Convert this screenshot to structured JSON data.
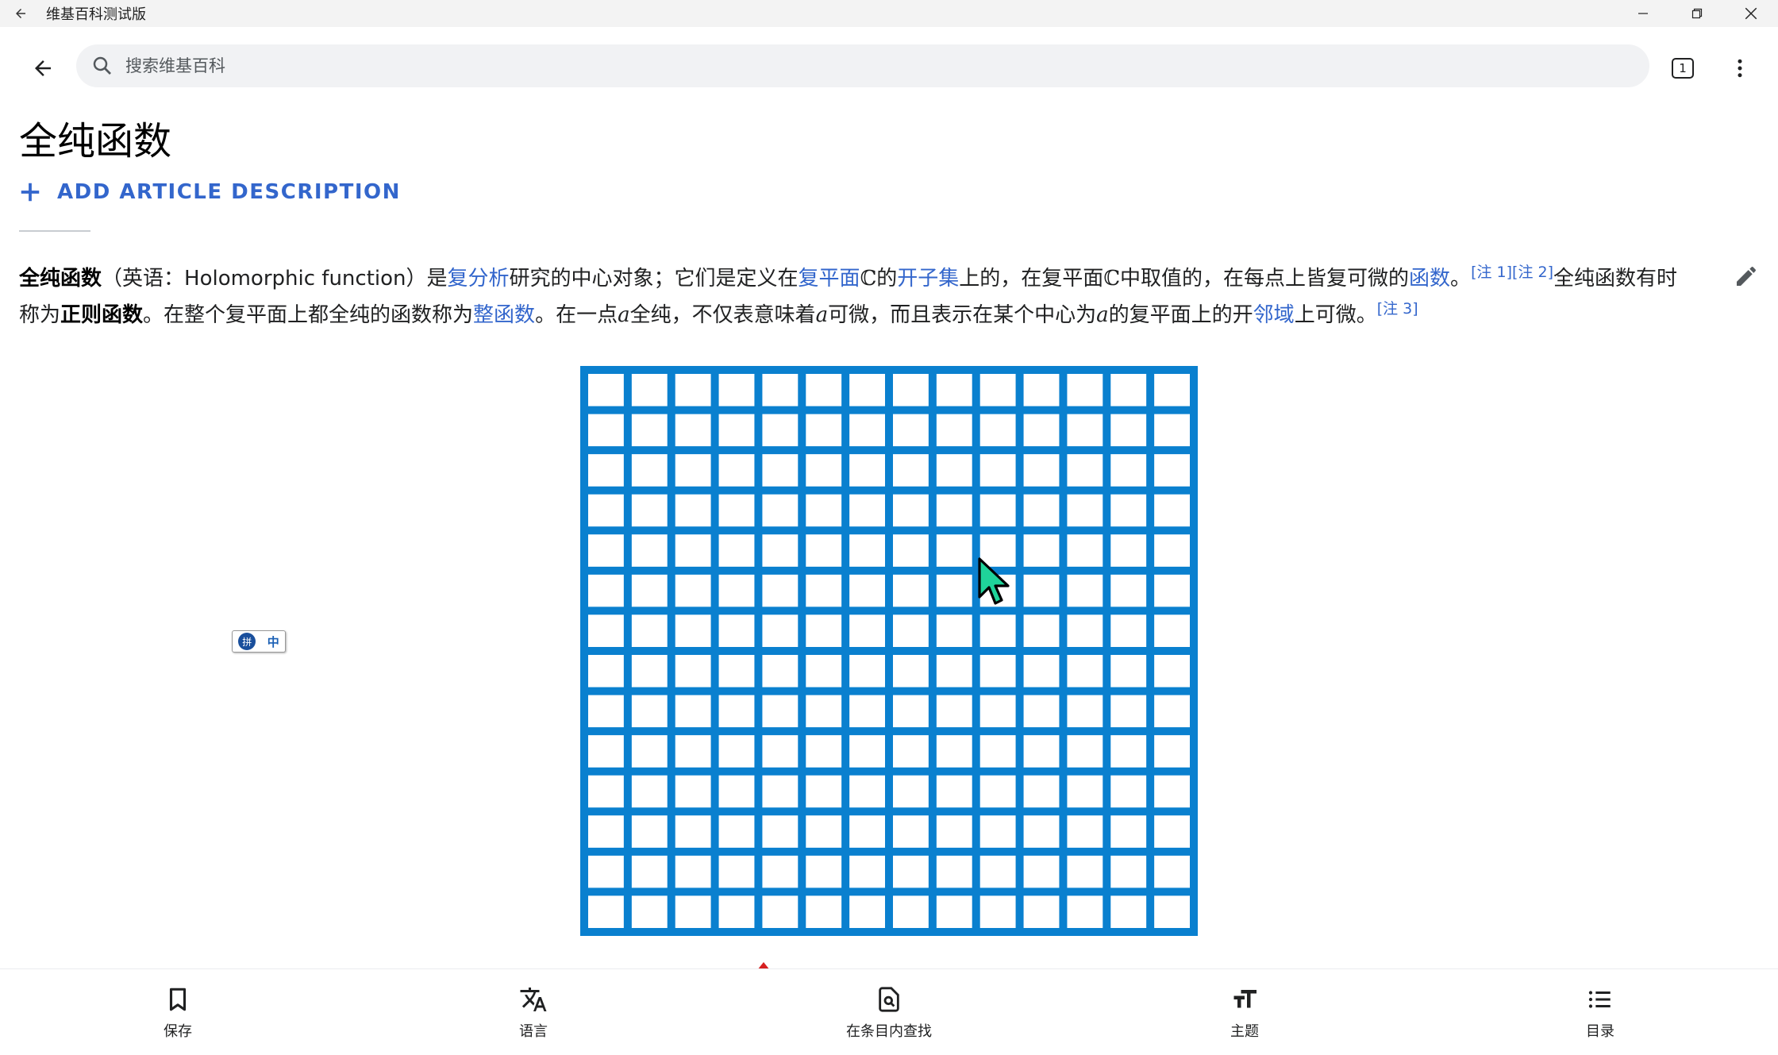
{
  "window": {
    "title": "维基百科测试版"
  },
  "toolbar": {
    "search_placeholder": "搜索维基百科",
    "tabs_count": "1"
  },
  "article": {
    "title": "全纯函数",
    "add_description": "ADD ARTICLE DESCRIPTION",
    "lead": {
      "s01": "全纯函数",
      "s02": "（英语：Holomorphic function）是",
      "s03": "复分析",
      "s04": "研究的中心对象；它们是定义在",
      "s05": "复平面",
      "s06": "ℂ",
      "s07": "的",
      "s08": "开子集",
      "s09": "上的，在复平面",
      "s10": "ℂ",
      "s11": "中取值的，在每点上皆复可微的",
      "s12": "函数",
      "s13": "。",
      "s14": "[注 1]",
      "s15": "[注 2]",
      "s16": "全纯函数有时称为",
      "s17": "正则函数",
      "s18": "。在整个复平面上都全纯的函数称为",
      "s19": "整函数",
      "s20": "。在一点",
      "s21": "a",
      "s22": "全纯，不仅表意味着",
      "s23": "a",
      "s24": "可微，而且表示在某个中心为",
      "s25": "a",
      "s26": "的复平面上的开",
      "s27": "邻域",
      "s28": "上可微。",
      "s29": "[注 3]"
    },
    "figure": {
      "grid_color": "#0a80cf",
      "cells_per_side": 14
    }
  },
  "ime": {
    "logo": "拼",
    "mode": "中"
  },
  "bottom_bar": {
    "items": [
      {
        "label": "保存",
        "icon": "bookmark-icon"
      },
      {
        "label": "语言",
        "icon": "translate-icon"
      },
      {
        "label": "在条目内查找",
        "icon": "find-in-page-icon"
      },
      {
        "label": "主题",
        "icon": "text-size-icon"
      },
      {
        "label": "目录",
        "icon": "list-icon"
      }
    ]
  },
  "colors": {
    "link": "#3366cc",
    "text": "#202122",
    "titlebar_bg": "#f3f3f3",
    "search_bg": "#f1f2f4"
  }
}
